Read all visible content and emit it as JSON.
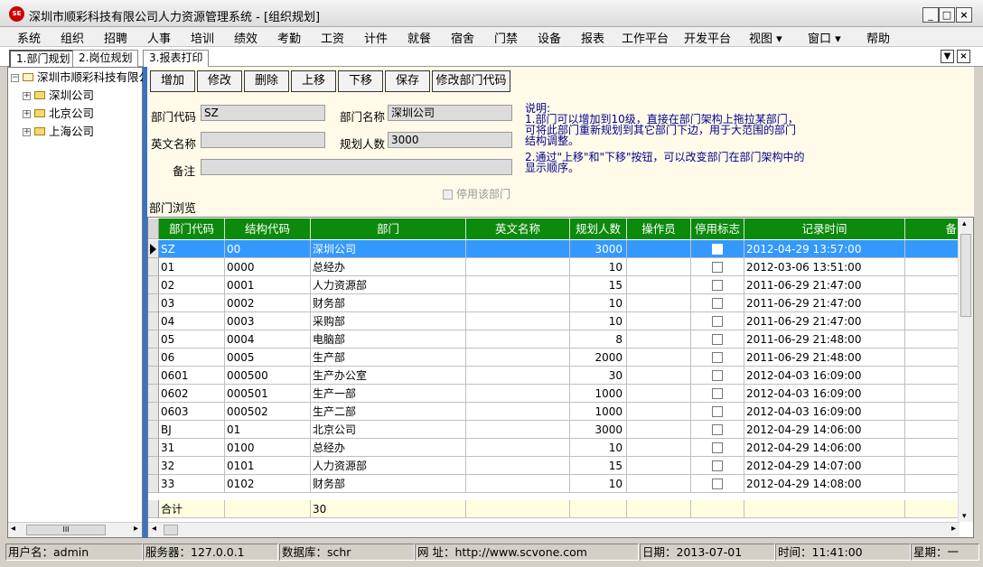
{
  "window": {
    "title": "深圳市顺彩科技有限公司人力资源管理系统 - [组织规划]",
    "icon_label": "SE",
    "controls": [
      "_",
      "□",
      "×"
    ]
  },
  "menu": [
    "系统",
    "组织",
    "招聘",
    "人事",
    "培训",
    "绩效",
    "考勤",
    "工资",
    "计件",
    "就餐",
    "宿舍",
    "门禁",
    "设备",
    "报表",
    "工作平台",
    "开发平台",
    "视图 ▾",
    "窗口 ▾",
    "帮助"
  ],
  "tabs": [
    {
      "label": "1.部门规划",
      "active": true
    },
    {
      "label": "2.岗位规划",
      "active": false
    },
    {
      "label": "3.报表打印",
      "active": false
    }
  ],
  "tab_controls": [
    "▼",
    "×"
  ],
  "tree": {
    "root": "深圳市顺彩科技有限公司",
    "children": [
      "深圳公司",
      "北京公司",
      "上海公司"
    ],
    "hscroll_thumb": "III"
  },
  "toolbar": {
    "add": "增加",
    "edit": "修改",
    "delete": "删除",
    "up": "上移",
    "down": "下移",
    "save": "保存",
    "change_code": "修改部门代码"
  },
  "form": {
    "dept_code_label": "部门代码",
    "dept_code_value": "SZ",
    "dept_name_label": "部门名称",
    "dept_name_value": "深圳公司",
    "en_name_label": "英文名称",
    "en_name_value": "",
    "plan_count_label": "规划人数",
    "plan_count_value": "3000",
    "remark_label": "备注",
    "remark_value": "",
    "disable_label": "停用该部门"
  },
  "note": {
    "title": "说明:",
    "line1": "1.部门可以增加到10级，直接在部门架构上拖拉某部门，可将此部门重新规划到其它部门下边，用于大范围的部门结构调整。",
    "line2": "2.通过\"上移\"和\"下移\"按钮，可以改变部门在部门架构中的显示顺序。"
  },
  "browse_label": "部门浏览",
  "grid": {
    "headers": [
      "部门代码",
      "结构代码",
      "部门",
      "英文名称",
      "规划人数",
      "操作员",
      "停用标志",
      "记录时间",
      "备"
    ],
    "rows": [
      {
        "code": "SZ",
        "struct": "00",
        "dept": "深圳公司",
        "en": "",
        "plan": "3000",
        "op": "",
        "time": "2012-04-29 13:57:00",
        "selected": true
      },
      {
        "code": "01",
        "struct": "0000",
        "dept": "总经办",
        "en": "",
        "plan": "10",
        "op": "",
        "time": "2012-03-06 13:51:00"
      },
      {
        "code": "02",
        "struct": "0001",
        "dept": "人力资源部",
        "en": "",
        "plan": "15",
        "op": "",
        "time": "2011-06-29 21:47:00"
      },
      {
        "code": "03",
        "struct": "0002",
        "dept": "财务部",
        "en": "",
        "plan": "10",
        "op": "",
        "time": "2011-06-29 21:47:00"
      },
      {
        "code": "04",
        "struct": "0003",
        "dept": "采购部",
        "en": "",
        "plan": "10",
        "op": "",
        "time": "2011-06-29 21:47:00"
      },
      {
        "code": "05",
        "struct": "0004",
        "dept": "电脑部",
        "en": "",
        "plan": "8",
        "op": "",
        "time": "2011-06-29 21:48:00"
      },
      {
        "code": "06",
        "struct": "0005",
        "dept": "生产部",
        "en": "",
        "plan": "2000",
        "op": "",
        "time": "2011-06-29 21:48:00"
      },
      {
        "code": "0601",
        "struct": "000500",
        "dept": "生产办公室",
        "en": "",
        "plan": "30",
        "op": "",
        "time": "2012-04-03 16:09:00"
      },
      {
        "code": "0602",
        "struct": "000501",
        "dept": "生产一部",
        "en": "",
        "plan": "1000",
        "op": "",
        "time": "2012-04-03 16:09:00"
      },
      {
        "code": "0603",
        "struct": "000502",
        "dept": "生产二部",
        "en": "",
        "plan": "1000",
        "op": "",
        "time": "2012-04-03 16:09:00"
      },
      {
        "code": "BJ",
        "struct": "01",
        "dept": "北京公司",
        "en": "",
        "plan": "3000",
        "op": "",
        "time": "2012-04-29 14:06:00"
      },
      {
        "code": "31",
        "struct": "0100",
        "dept": "总经办",
        "en": "",
        "plan": "10",
        "op": "",
        "time": "2012-04-29 14:06:00"
      },
      {
        "code": "32",
        "struct": "0101",
        "dept": "人力资源部",
        "en": "",
        "plan": "15",
        "op": "",
        "time": "2012-04-29 14:07:00"
      },
      {
        "code": "33",
        "struct": "0102",
        "dept": "财务部",
        "en": "",
        "plan": "10",
        "op": "",
        "time": "2012-04-29 14:08:00"
      }
    ],
    "total_label": "合计",
    "total_struct": "",
    "total_value": "30"
  },
  "status": {
    "user": "用户名：admin",
    "server": "服务器：127.0.0.1",
    "db": "数据库：schr",
    "web": "网  址：http://www.scvone.com",
    "date": "日期：2013-07-01",
    "time": "时间：11:41:00",
    "weekday": "星期：一"
  },
  "colors": {
    "header_green": "#0b8a0b",
    "selection_blue": "#3399ff",
    "splitter_blue": "#3a73c4",
    "note_text": "#00008b"
  }
}
